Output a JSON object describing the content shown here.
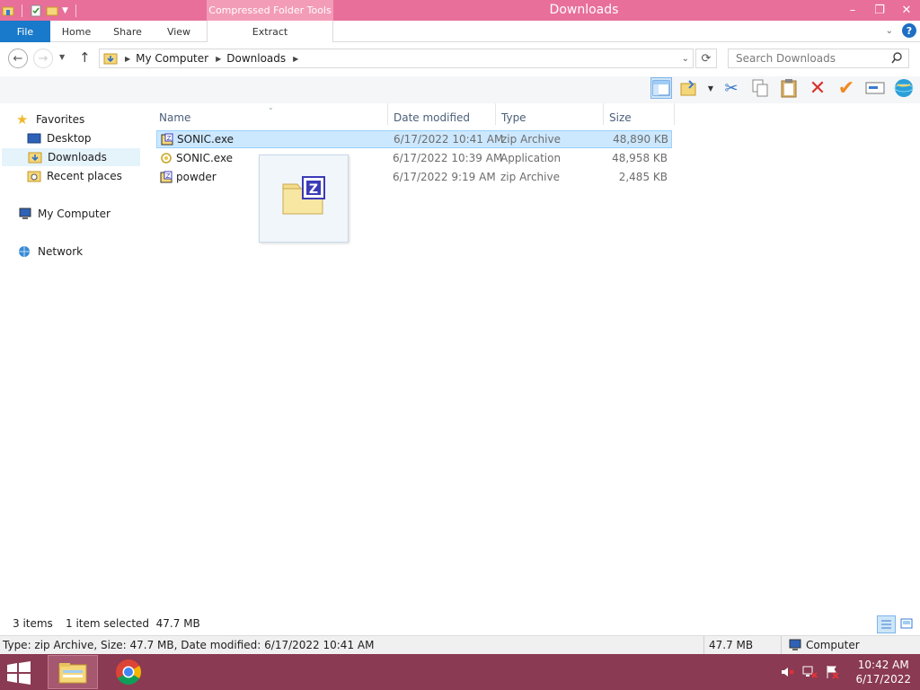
{
  "titlebar": {
    "title": "Downloads",
    "contextual_group": "Compressed Folder Tools",
    "minimize": "–",
    "maximize": "❐",
    "close": "✕"
  },
  "ribbon": {
    "tabs": [
      "File",
      "Home",
      "Share",
      "View",
      "Extract"
    ]
  },
  "address": {
    "crumbs": [
      "My Computer",
      "Downloads"
    ],
    "search_placeholder": "Search Downloads"
  },
  "nav": {
    "favorites": "Favorites",
    "desktop": "Desktop",
    "downloads": "Downloads",
    "recent": "Recent places",
    "computer": "My Computer",
    "network": "Network"
  },
  "columns": [
    "Name",
    "Date modified",
    "Type",
    "Size"
  ],
  "files": [
    {
      "name": "SONIC.exe",
      "date": "6/17/2022 10:41 AM",
      "type": "zip Archive",
      "size": "48,890 KB"
    },
    {
      "name": "SONIC.exe",
      "date": "6/17/2022 10:39 AM",
      "type": "Application",
      "size": "48,958 KB"
    },
    {
      "name": "powder",
      "date": "6/17/2022 9:19 AM",
      "type": "zip Archive",
      "size": "2,485 KB"
    }
  ],
  "status": {
    "items": "3 items",
    "selected": "1 item selected  47.7 MB"
  },
  "details": {
    "text": "Type: zip Archive, Size: 47.7 MB, Date modified: 6/17/2022 10:41 AM",
    "size": "47.7 MB",
    "location": "Computer"
  },
  "clock": {
    "time": "10:42 AM",
    "date": "6/17/2022"
  },
  "colors": {
    "titlebar": "#e86f9a",
    "file_tab": "#1979ca",
    "taskbar": "#8a3a52",
    "selection": "#cce8ff"
  }
}
